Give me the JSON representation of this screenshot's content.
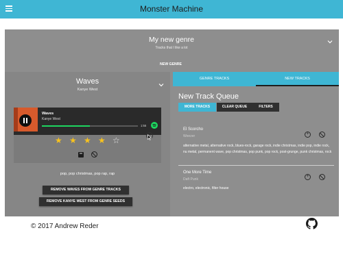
{
  "header": {
    "title": "Monster Machine",
    "menu_icon": "hamburger-icon"
  },
  "genre": {
    "title": "My new genre",
    "subtitle": "Tracks that I like a lot",
    "new_genre_label": "NEW GENRE"
  },
  "track": {
    "title": "Waves",
    "artist": "Kanye West",
    "player": {
      "title": "Waves",
      "artist": "Kanye West",
      "time": "1:55",
      "progress": 0.5
    },
    "rating": 4,
    "rating_max": 5,
    "genres": "pop, pop christmas, pop rap, rap",
    "remove_track_label": "REMOVE WAVES FROM GENRE TRACKS",
    "remove_artist_label": "REMOVE KANYE WEST FROM GENRE SEEDS"
  },
  "queue": {
    "tabs": [
      {
        "label": "GENRE TRACKS"
      },
      {
        "label": "NEW TRACKS"
      }
    ],
    "active_tab": 1,
    "title": "New Track Queue",
    "buttons": {
      "more": "MORE TRACKS",
      "clear": "CLEAR QUEUE",
      "filters": "FILTERS"
    },
    "items": [
      {
        "name": "El Scorcho",
        "artist": "Weezer",
        "genres": "alternative metal, alternative rock, blues-rock, garage rock, indie christmas, indie pop, indie rock, nu metal, permanent wave, pop christmas, pop punk, pop rock, post-grunge, punk christmas, rock"
      },
      {
        "name": "One More Time",
        "artist": "Daft Punk",
        "genres": "electro, electronic, filter house"
      }
    ]
  },
  "footer": {
    "copyright": "© 2017 Andrew Reder",
    "icon": "github-icon"
  },
  "colors": {
    "header": "#3fb6d4",
    "panel": "#8e8e8e",
    "player": "#2a2a2a",
    "progress": "#1ed760",
    "star": "#f7c21e",
    "button_dark": "#303030"
  }
}
